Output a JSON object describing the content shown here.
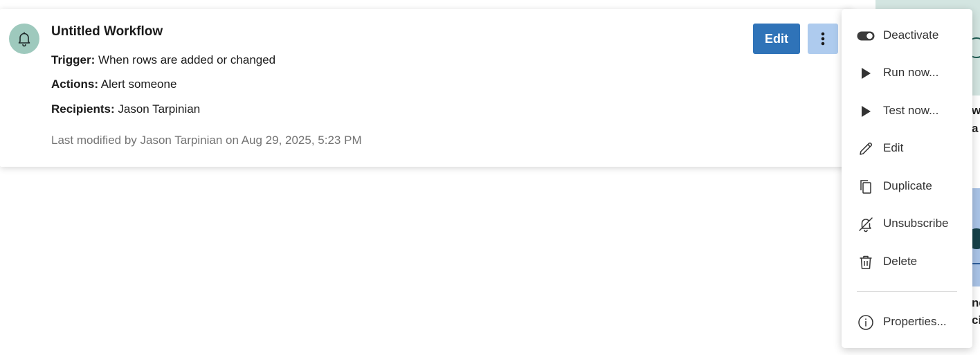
{
  "workflow": {
    "title": "Untitled Workflow",
    "trigger_label": "Trigger:",
    "trigger_value": "When rows are added or changed",
    "actions_label": "Actions:",
    "actions_value": "Alert someone",
    "recipients_label": "Recipients:",
    "recipients_value": "Jason Tarpinian",
    "last_modified": "Last modified by Jason Tarpinian on Aug 29, 2025, 5:23 PM",
    "avatar_icon": "bell-icon",
    "edit_button_label": "Edit",
    "more_button_icon": "more-vertical-icon"
  },
  "menu": {
    "items": [
      {
        "label": "Deactivate",
        "icon": "toggle-icon"
      },
      {
        "label": "Run now...",
        "icon": "play-icon"
      },
      {
        "label": "Test now...",
        "icon": "play-icon"
      },
      {
        "label": "Edit",
        "icon": "pencil-icon"
      },
      {
        "label": "Duplicate",
        "icon": "copy-icon"
      },
      {
        "label": "Unsubscribe",
        "icon": "bell-off-icon"
      },
      {
        "label": "Delete",
        "icon": "trash-icon"
      },
      {
        "label": "Properties...",
        "icon": "info-icon"
      }
    ]
  },
  "background": {
    "text_fragments": [
      "wh",
      "a a",
      "nd",
      "ci"
    ]
  },
  "colors": {
    "primary": "#2f73b8",
    "primary_light": "#aecbee",
    "avatar_bg": "#9ec9bd",
    "muted_text": "#737373"
  }
}
